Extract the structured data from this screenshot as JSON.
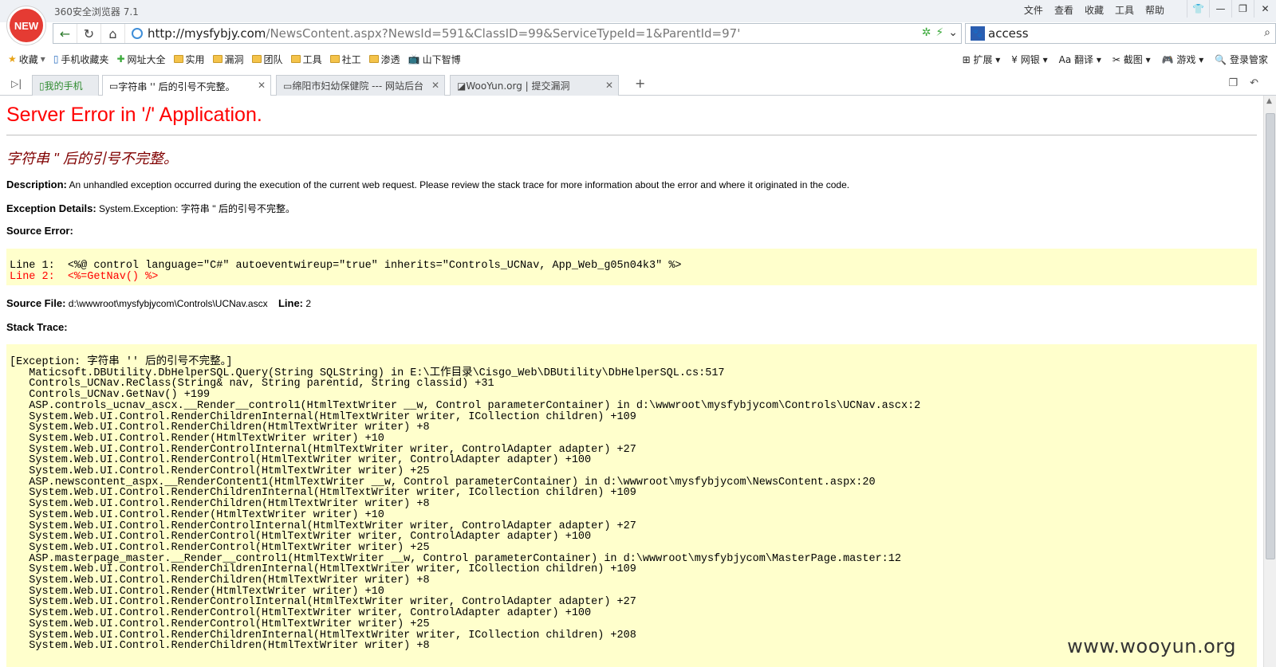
{
  "browser": {
    "badge": "NEW",
    "app_title": "360安全浏览器 7.1",
    "menus": [
      "文件",
      "查看",
      "收藏",
      "工具",
      "帮助"
    ],
    "url_domain": "http://mysfybjy.com",
    "url_path": "/NewsContent.aspx?NewsId=591&ClassID=99&ServiceTypeId=1&ParentId=97'",
    "search_value": "access",
    "bookmarks": [
      "收藏",
      "手机收藏夹",
      "网址大全",
      "实用",
      "漏洞",
      "团队",
      "工具",
      "社工",
      "渗透",
      "山下智博"
    ],
    "bookmarks_right": [
      "扩展",
      "网银",
      "翻译",
      "截图",
      "游戏",
      "登录管家"
    ],
    "tabs": [
      {
        "label": "我的手机"
      },
      {
        "label": "字符串 '' 后的引号不完整。"
      },
      {
        "label": "绵阳市妇幼保健院 --- 网站后台"
      },
      {
        "label": "WooYun.org | 提交漏洞"
      }
    ]
  },
  "page": {
    "title": "Server Error in '/' Application.",
    "subtitle": "字符串 '' 后的引号不完整。",
    "description_label": "Description:",
    "description_text": "An unhandled exception occurred during the execution of the current web request. Please review the stack trace for more information about the error and where it originated in the code.",
    "exception_label": "Exception Details:",
    "exception_text": "System.Exception: 字符串 '' 后的引号不完整。",
    "source_error_label": "Source Error:",
    "source_line1": "Line 1:  <%@ control language=\"C#\" autoeventwireup=\"true\" inherits=\"Controls_UCNav, App_Web_g05n04k3\" %>",
    "source_line2": "Line 2:  <%=GetNav() %>",
    "source_file_label": "Source File:",
    "source_file_value": "d:\\wwwroot\\mysfybjycom\\Controls\\UCNav.ascx",
    "line_label": "Line:",
    "line_value": "2",
    "stack_trace_label": "Stack Trace:",
    "stack_trace": "[Exception: 字符串 '' 后的引号不完整。]\n   Maticsoft.DBUtility.DbHelperSQL.Query(String SQLString) in E:\\工作目录\\Cisgo_Web\\DBUtility\\DbHelperSQL.cs:517\n   Controls_UCNav.ReClass(String& nav, String parentid, String classid) +31\n   Controls_UCNav.GetNav() +199\n   ASP.controls_ucnav_ascx.__Render__control1(HtmlTextWriter __w, Control parameterContainer) in d:\\wwwroot\\mysfybjycom\\Controls\\UCNav.ascx:2\n   System.Web.UI.Control.RenderChildrenInternal(HtmlTextWriter writer, ICollection children) +109\n   System.Web.UI.Control.RenderChildren(HtmlTextWriter writer) +8\n   System.Web.UI.Control.Render(HtmlTextWriter writer) +10\n   System.Web.UI.Control.RenderControlInternal(HtmlTextWriter writer, ControlAdapter adapter) +27\n   System.Web.UI.Control.RenderControl(HtmlTextWriter writer, ControlAdapter adapter) +100\n   System.Web.UI.Control.RenderControl(HtmlTextWriter writer) +25\n   ASP.newscontent_aspx.__RenderContent1(HtmlTextWriter __w, Control parameterContainer) in d:\\wwwroot\\mysfybjycom\\NewsContent.aspx:20\n   System.Web.UI.Control.RenderChildrenInternal(HtmlTextWriter writer, ICollection children) +109\n   System.Web.UI.Control.RenderChildren(HtmlTextWriter writer) +8\n   System.Web.UI.Control.Render(HtmlTextWriter writer) +10\n   System.Web.UI.Control.RenderControlInternal(HtmlTextWriter writer, ControlAdapter adapter) +27\n   System.Web.UI.Control.RenderControl(HtmlTextWriter writer, ControlAdapter adapter) +100\n   System.Web.UI.Control.RenderControl(HtmlTextWriter writer) +25\n   ASP.masterpage_master.__Render__control1(HtmlTextWriter __w, Control parameterContainer) in d:\\wwwroot\\mysfybjycom\\MasterPage.master:12\n   System.Web.UI.Control.RenderChildrenInternal(HtmlTextWriter writer, ICollection children) +109\n   System.Web.UI.Control.RenderChildren(HtmlTextWriter writer) +8\n   System.Web.UI.Control.Render(HtmlTextWriter writer) +10\n   System.Web.UI.Control.RenderControlInternal(HtmlTextWriter writer, ControlAdapter adapter) +27\n   System.Web.UI.Control.RenderControl(HtmlTextWriter writer, ControlAdapter adapter) +100\n   System.Web.UI.Control.RenderControl(HtmlTextWriter writer) +25\n   System.Web.UI.Control.RenderChildrenInternal(HtmlTextWriter writer, ICollection children) +208\n   System.Web.UI.Control.RenderChildren(HtmlTextWriter writer) +8",
    "watermark": "www.wooyun.org"
  }
}
